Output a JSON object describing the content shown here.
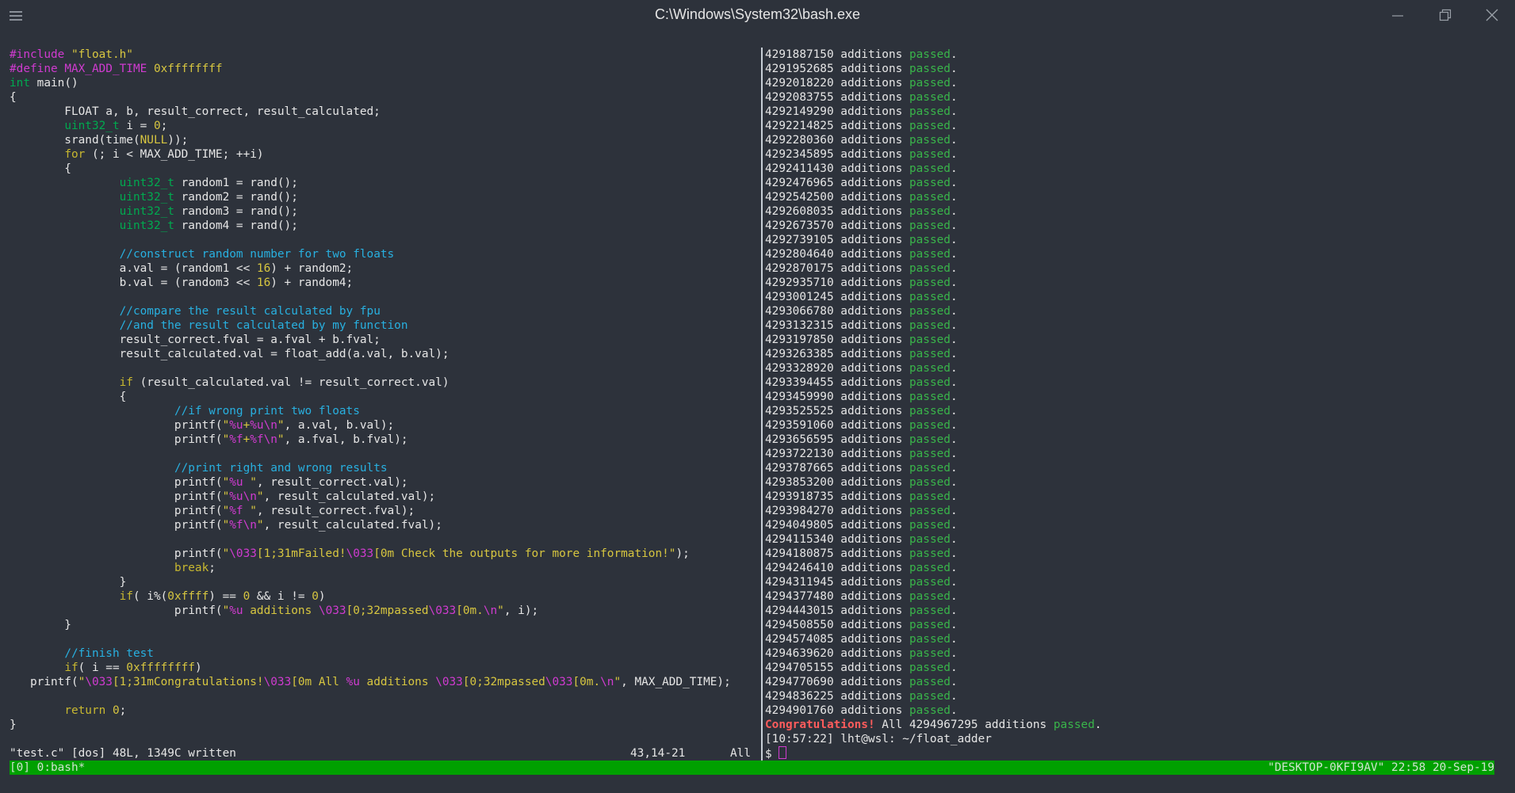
{
  "window": {
    "title": "C:\\Windows\\System32\\bash.exe"
  },
  "editor": {
    "code": [
      [
        {
          "t": "#include ",
          "c": "pp"
        },
        {
          "t": "\"float.h\"",
          "c": "str"
        }
      ],
      [
        {
          "t": "#define ",
          "c": "pp"
        },
        {
          "t": "MAX_ADD_TIME ",
          "c": "pp"
        },
        {
          "t": "0xffffffff",
          "c": "num"
        }
      ],
      [
        {
          "t": "int",
          "c": "ty"
        },
        {
          "t": " main()"
        }
      ],
      [
        {
          "t": "{"
        }
      ],
      [
        {
          "t": "        FLOAT a, b, result_correct, result_calculated;"
        }
      ],
      [
        {
          "t": "        "
        },
        {
          "t": "uint32_t",
          "c": "ty"
        },
        {
          "t": " i = "
        },
        {
          "t": "0",
          "c": "num"
        },
        {
          "t": ";"
        }
      ],
      [
        {
          "t": "        srand(time("
        },
        {
          "t": "NULL",
          "c": "num"
        },
        {
          "t": "));"
        }
      ],
      [
        {
          "t": "        "
        },
        {
          "t": "for",
          "c": "kw"
        },
        {
          "t": " (; i < MAX_ADD_TIME; ++i)"
        }
      ],
      [
        {
          "t": "        {"
        }
      ],
      [
        {
          "t": "                "
        },
        {
          "t": "uint32_t",
          "c": "ty"
        },
        {
          "t": " random1 = rand();"
        }
      ],
      [
        {
          "t": "                "
        },
        {
          "t": "uint32_t",
          "c": "ty"
        },
        {
          "t": " random2 = rand();"
        }
      ],
      [
        {
          "t": "                "
        },
        {
          "t": "uint32_t",
          "c": "ty"
        },
        {
          "t": " random3 = rand();"
        }
      ],
      [
        {
          "t": "                "
        },
        {
          "t": "uint32_t",
          "c": "ty"
        },
        {
          "t": " random4 = rand();"
        }
      ],
      [
        {
          "t": ""
        }
      ],
      [
        {
          "t": "                "
        },
        {
          "t": "//construct random number for two floats",
          "c": "cm"
        }
      ],
      [
        {
          "t": "                a.val = (random1 << "
        },
        {
          "t": "16",
          "c": "num"
        },
        {
          "t": ") + random2;"
        }
      ],
      [
        {
          "t": "                b.val = (random3 << "
        },
        {
          "t": "16",
          "c": "num"
        },
        {
          "t": ") + random4;"
        }
      ],
      [
        {
          "t": ""
        }
      ],
      [
        {
          "t": "                "
        },
        {
          "t": "//compare the result calculated by fpu",
          "c": "cm"
        }
      ],
      [
        {
          "t": "                "
        },
        {
          "t": "//and the result calculated by my function",
          "c": "cm"
        }
      ],
      [
        {
          "t": "                result_correct.fval = a.fval + b.fval;"
        }
      ],
      [
        {
          "t": "                result_calculated.val = float_add(a.val, b.val);"
        }
      ],
      [
        {
          "t": ""
        }
      ],
      [
        {
          "t": "                "
        },
        {
          "t": "if",
          "c": "kw"
        },
        {
          "t": " (result_calculated.val != result_correct.val)"
        }
      ],
      [
        {
          "t": "                {"
        }
      ],
      [
        {
          "t": "                        "
        },
        {
          "t": "//if wrong print two floats",
          "c": "cm"
        }
      ],
      [
        {
          "t": "                        printf("
        },
        {
          "t": "\"",
          "c": "str"
        },
        {
          "t": "%u",
          "c": "esc"
        },
        {
          "t": "+",
          "c": "str"
        },
        {
          "t": "%u",
          "c": "esc"
        },
        {
          "t": "\\n",
          "c": "esc"
        },
        {
          "t": "\"",
          "c": "str"
        },
        {
          "t": ", a.val, b.val);"
        }
      ],
      [
        {
          "t": "                        printf("
        },
        {
          "t": "\"",
          "c": "str"
        },
        {
          "t": "%f",
          "c": "esc"
        },
        {
          "t": "+",
          "c": "str"
        },
        {
          "t": "%f",
          "c": "esc"
        },
        {
          "t": "\\n",
          "c": "esc"
        },
        {
          "t": "\"",
          "c": "str"
        },
        {
          "t": ", a.fval, b.fval);"
        }
      ],
      [
        {
          "t": ""
        }
      ],
      [
        {
          "t": "                        "
        },
        {
          "t": "//print right and wrong results",
          "c": "cm"
        }
      ],
      [
        {
          "t": "                        printf("
        },
        {
          "t": "\"",
          "c": "str"
        },
        {
          "t": "%u",
          "c": "esc"
        },
        {
          "t": " \"",
          "c": "str"
        },
        {
          "t": ", result_correct.val);"
        }
      ],
      [
        {
          "t": "                        printf("
        },
        {
          "t": "\"",
          "c": "str"
        },
        {
          "t": "%u",
          "c": "esc"
        },
        {
          "t": "\\n",
          "c": "esc"
        },
        {
          "t": "\"",
          "c": "str"
        },
        {
          "t": ", result_calculated.val);"
        }
      ],
      [
        {
          "t": "                        printf("
        },
        {
          "t": "\"",
          "c": "str"
        },
        {
          "t": "%f",
          "c": "esc"
        },
        {
          "t": " \"",
          "c": "str"
        },
        {
          "t": ", result_correct.fval);"
        }
      ],
      [
        {
          "t": "                        printf("
        },
        {
          "t": "\"",
          "c": "str"
        },
        {
          "t": "%f",
          "c": "esc"
        },
        {
          "t": "\\n",
          "c": "esc"
        },
        {
          "t": "\"",
          "c": "str"
        },
        {
          "t": ", result_calculated.fval);"
        }
      ],
      [
        {
          "t": ""
        }
      ],
      [
        {
          "t": "                        printf("
        },
        {
          "t": "\"",
          "c": "str"
        },
        {
          "t": "\\033",
          "c": "esc"
        },
        {
          "t": "[1;31mFailed!",
          "c": "str"
        },
        {
          "t": "\\033",
          "c": "esc"
        },
        {
          "t": "[0m Check the outputs for more information!\"",
          "c": "str"
        },
        {
          "t": ");"
        }
      ],
      [
        {
          "t": "                        "
        },
        {
          "t": "break",
          "c": "kw"
        },
        {
          "t": ";"
        }
      ],
      [
        {
          "t": "                }"
        }
      ],
      [
        {
          "t": "                "
        },
        {
          "t": "if",
          "c": "kw"
        },
        {
          "t": "( i%("
        },
        {
          "t": "0xffff",
          "c": "num"
        },
        {
          "t": ") == "
        },
        {
          "t": "0",
          "c": "num"
        },
        {
          "t": " && i != "
        },
        {
          "t": "0",
          "c": "num"
        },
        {
          "t": ")"
        }
      ],
      [
        {
          "t": "                        printf("
        },
        {
          "t": "\"",
          "c": "str"
        },
        {
          "t": "%u",
          "c": "esc"
        },
        {
          "t": " additions ",
          "c": "str"
        },
        {
          "t": "\\033",
          "c": "esc"
        },
        {
          "t": "[0;32mpassed",
          "c": "str"
        },
        {
          "t": "\\033",
          "c": "esc"
        },
        {
          "t": "[0m.",
          "c": "str"
        },
        {
          "t": "\\n",
          "c": "esc"
        },
        {
          "t": "\"",
          "c": "str"
        },
        {
          "t": ", i);"
        }
      ],
      [
        {
          "t": "        }"
        }
      ],
      [
        {
          "t": ""
        }
      ],
      [
        {
          "t": "        "
        },
        {
          "t": "//finish test",
          "c": "cm"
        }
      ],
      [
        {
          "t": "        "
        },
        {
          "t": "if",
          "c": "kw"
        },
        {
          "t": "( i == "
        },
        {
          "t": "0xffffffff",
          "c": "num"
        },
        {
          "t": ")"
        }
      ],
      [
        {
          "t": "   printf("
        },
        {
          "t": "\"",
          "c": "str"
        },
        {
          "t": "\\033",
          "c": "esc"
        },
        {
          "t": "[1;31mCongratulations!",
          "c": "str"
        },
        {
          "t": "\\033",
          "c": "esc"
        },
        {
          "t": "[0m All ",
          "c": "str"
        },
        {
          "t": "%u",
          "c": "esc"
        },
        {
          "t": " additions ",
          "c": "str"
        },
        {
          "t": "\\033",
          "c": "esc"
        },
        {
          "t": "[0;32mpassed",
          "c": "str"
        },
        {
          "t": "\\033",
          "c": "esc"
        },
        {
          "t": "[0m.",
          "c": "str"
        },
        {
          "t": "\\n",
          "c": "esc"
        },
        {
          "t": "\"",
          "c": "str"
        },
        {
          "t": ", MAX_ADD_TIME);"
        }
      ],
      [
        {
          "t": ""
        }
      ],
      [
        {
          "t": "        "
        },
        {
          "t": "return",
          "c": "kw"
        },
        {
          "t": " "
        },
        {
          "t": "0",
          "c": "num"
        },
        {
          "t": ";"
        }
      ],
      [
        {
          "t": "}"
        }
      ]
    ],
    "status_file": "\"test.c\" [dos] 48L, 1349C written",
    "status_pos": "43,14-21",
    "status_all": "All"
  },
  "output": {
    "lines": [
      "4291887150",
      "4291952685",
      "4292018220",
      "4292083755",
      "4292149290",
      "4292214825",
      "4292280360",
      "4292345895",
      "4292411430",
      "4292476965",
      "4292542500",
      "4292608035",
      "4292673570",
      "4292739105",
      "4292804640",
      "4292870175",
      "4292935710",
      "4293001245",
      "4293066780",
      "4293132315",
      "4293197850",
      "4293263385",
      "4293328920",
      "4293394455",
      "4293459990",
      "4293525525",
      "4293591060",
      "4293656595",
      "4293722130",
      "4293787665",
      "4293853200",
      "4293918735",
      "4293984270",
      "4294049805",
      "4294115340",
      "4294180875",
      "4294246410",
      "4294311945",
      "4294377480",
      "4294443015",
      "4294508550",
      "4294574085",
      "4294639620",
      "4294705155",
      "4294770690",
      "4294836225",
      "4294901760"
    ],
    "additions_word": " additions ",
    "passed_word": "passed",
    "period": ".",
    "congrats_label": "Congratulations!",
    "congrats_mid": " All 4294967295 additions ",
    "prompt_line": "[10:57:22] lht@wsl: ~/float_adder",
    "prompt_symbol": "$ "
  },
  "tmux": {
    "left": "[0] 0:bash*",
    "right": "\"DESKTOP-0KFI9AV\" 22:58 20-Sep-19"
  }
}
